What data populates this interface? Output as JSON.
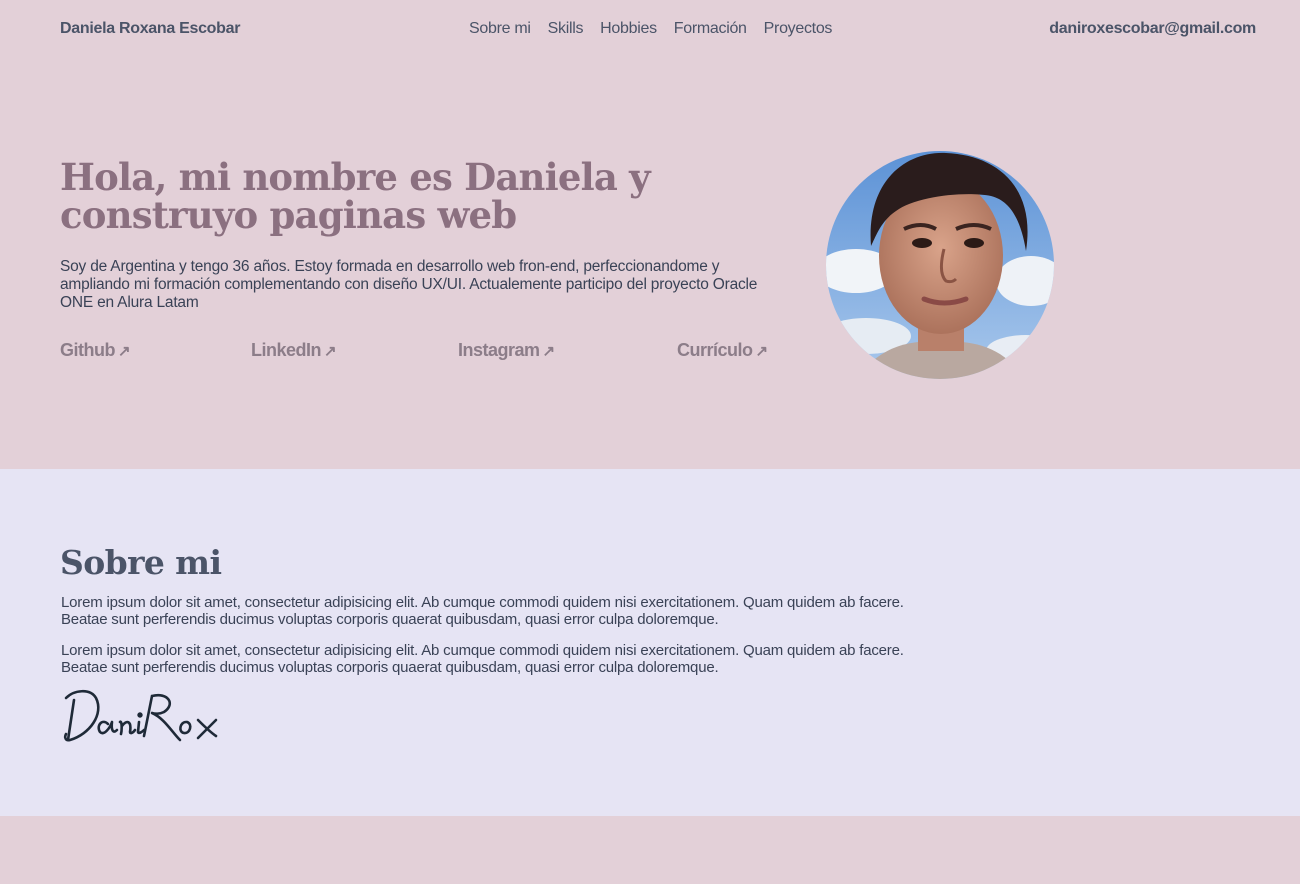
{
  "header": {
    "brand": "Daniela Roxana Escobar",
    "nav": [
      "Sobre mi",
      "Skills",
      "Hobbies",
      "Formación",
      "Proyectos"
    ],
    "email": "daniroxescobar@gmail.com"
  },
  "hero": {
    "title": "Hola, mi nombre es Daniela y construyo paginas web",
    "text": "Soy de Argentina y tengo 36 años. Estoy formada en desarrollo web fron-end, perfeccionandome y ampliando mi formación complementando con diseño UX/UI. Actualemente participo del proyecto Oracle ONE en Alura Latam",
    "links": [
      {
        "label": "Github",
        "icon": "arrow-up-right-icon"
      },
      {
        "label": "LinkedIn",
        "icon": "arrow-up-right-icon"
      },
      {
        "label": "Instagram",
        "icon": "arrow-up-right-icon"
      },
      {
        "label": "Currículo",
        "icon": "arrow-up-right-icon"
      }
    ],
    "arrow_glyph": "↗"
  },
  "about": {
    "title": "Sobre mi",
    "paragraphs": [
      "Lorem ipsum dolor sit amet, consectetur adipisicing elit. Ab cumque commodi quidem nisi exercitationem. Quam quidem ab facere. Beatae sunt perferendis ducimus voluptas corporis quaerat quibusdam, quasi error culpa doloremque.",
      "Lorem ipsum dolor sit amet, consectetur adipisicing elit. Ab cumque commodi quidem nisi exercitationem. Quam quidem ab facere. Beatae sunt perferendis ducimus voluptas corporis quaerat quibusdam, quasi error culpa doloremque."
    ],
    "signature": "DaniRox"
  },
  "colors": {
    "page_bg": "#e3d0d8",
    "about_bg": "#e6e4f4",
    "title_accent": "#8b7080",
    "text": "#3a4256"
  }
}
